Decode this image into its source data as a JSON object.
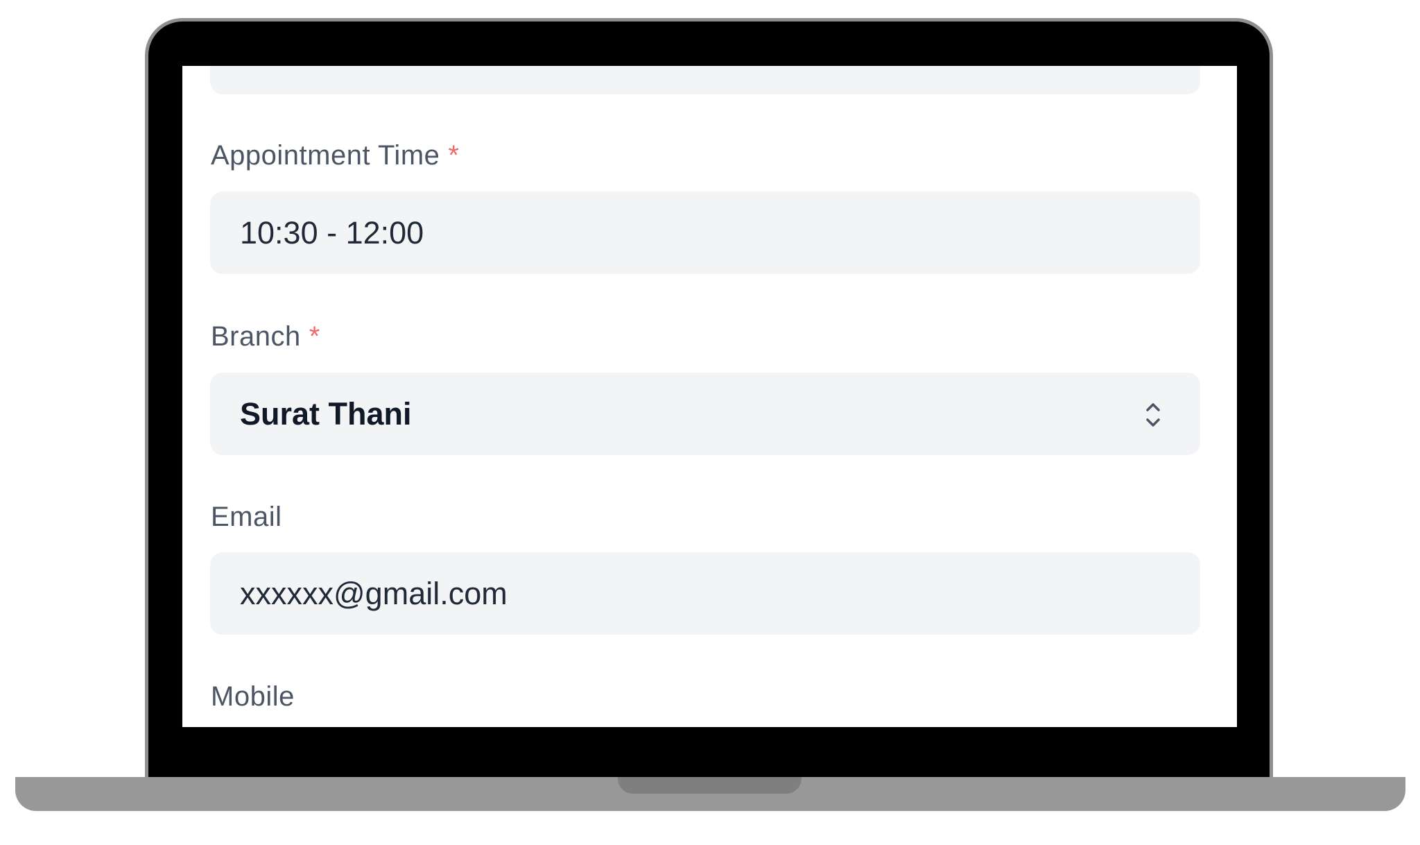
{
  "form": {
    "appointment_time": {
      "label": "Appointment Time",
      "required_mark": "*",
      "value": "10:30 - 12:00"
    },
    "branch": {
      "label": "Branch",
      "required_mark": "*",
      "value": "Surat Thani",
      "icon": "chevron-up-down-icon"
    },
    "email": {
      "label": "Email",
      "value": "xxxxxx@gmail.com"
    },
    "mobile": {
      "label": "Mobile"
    }
  },
  "colors": {
    "field_background": "#f3f4f6",
    "label_text": "#4b5563",
    "required_asterisk": "#ef6b6b",
    "value_text": "#1f2937",
    "laptop_bezel": "#000000",
    "laptop_body": "#989898"
  }
}
